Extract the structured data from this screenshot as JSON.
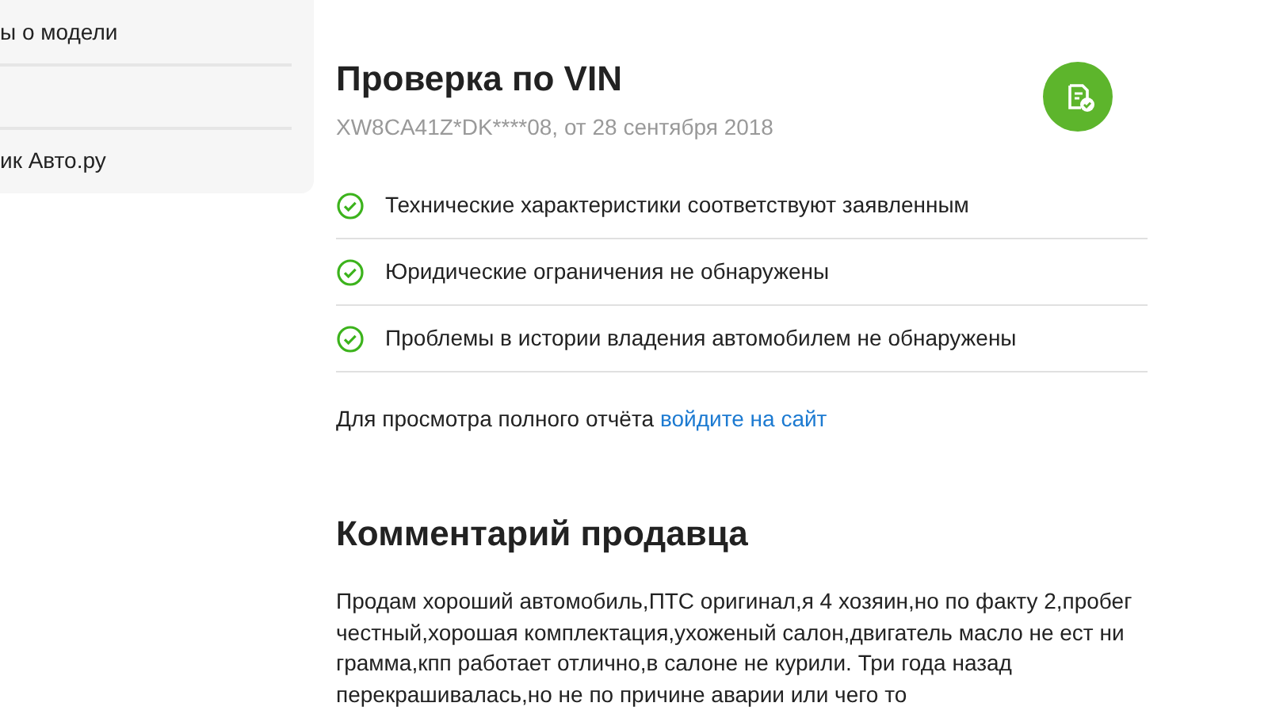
{
  "sidebar": {
    "items": [
      {
        "kind": "link",
        "label": "ы о модели"
      },
      {
        "kind": "spacer"
      },
      {
        "kind": "link",
        "label": "ик Авто.ру"
      }
    ]
  },
  "vin_check": {
    "title": "Проверка по VIN",
    "subtitle": "XW8CA41Z*DK****08, от 28 сентября 2018",
    "checks": [
      {
        "label": "Технические характеристики соответствуют заявленным",
        "passed": true
      },
      {
        "label": "Юридические ограничения не обнаружены",
        "passed": true
      },
      {
        "label": "Проблемы в истории владения автомобилем не обнаружены",
        "passed": true
      }
    ],
    "report_note": "Для просмотра полного отчёта",
    "report_link": "войдите на сайт"
  },
  "seller_comment": {
    "title": "Комментарий продавца",
    "text": "Продам хороший автомобиль,ПТС оригинал,я 4 хозяин,но по факту 2,пробег честный,хорошая комплектация,ухоженый салон,двигатель масло не ест ни грамма,кпп работает отлично,в салоне не курили. Три года назад перекрашивалась,но не по причине аварии или чего то"
  }
}
